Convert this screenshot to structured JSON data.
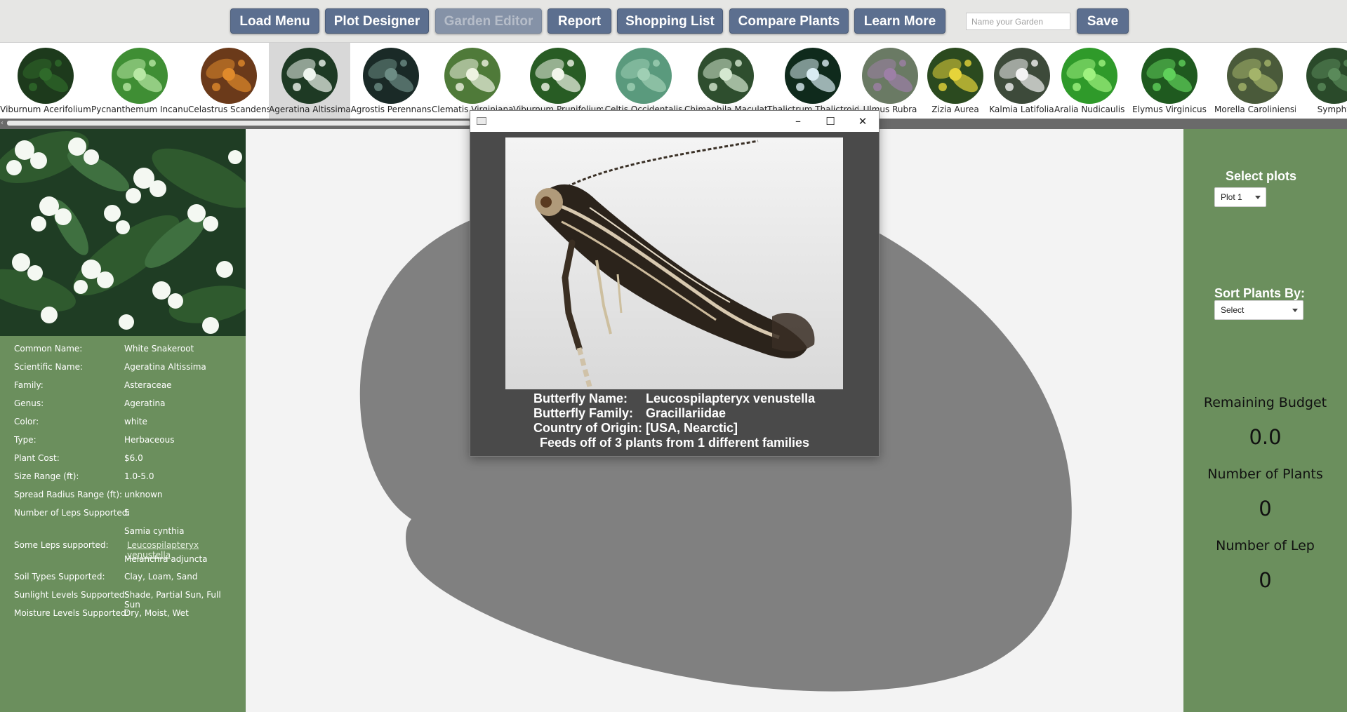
{
  "toolbar": {
    "buttons": [
      {
        "label": "Load Menu",
        "enabled": true
      },
      {
        "label": "Plot Designer",
        "enabled": true
      },
      {
        "label": "Garden Editor",
        "enabled": false
      },
      {
        "label": "Report",
        "enabled": true
      },
      {
        "label": "Shopping List",
        "enabled": true
      },
      {
        "label": "Compare Plants",
        "enabled": true
      },
      {
        "label": "Learn More",
        "enabled": true
      }
    ],
    "garden_name": {
      "value": "",
      "placeholder": "Name your Garden"
    },
    "save_label": "Save"
  },
  "plant_strip": {
    "selected_index": 3,
    "plants": [
      {
        "name": "Viburnum Acerifolium",
        "bg": "#1d3a1c",
        "fg": "#2f6a2a"
      },
      {
        "name": "Pycnanthemum Incanum",
        "bg": "#3f8e34",
        "fg": "#b8e8a4"
      },
      {
        "name": "Celastrus Scandens",
        "bg": "#6b3a1a",
        "fg": "#e08a2b"
      },
      {
        "name": "Ageratina Altissima",
        "bg": "#1e3a24",
        "fg": "#eef5ee"
      },
      {
        "name": "Agrostis Perennans",
        "bg": "#1a2a27",
        "fg": "#6c8c84"
      },
      {
        "name": "Clematis Virginiana",
        "bg": "#4f7a39",
        "fg": "#eef3e1"
      },
      {
        "name": "Viburnum Prunifolium",
        "bg": "#285c24",
        "fg": "#f1f6ea"
      },
      {
        "name": "Celtis Occidentalis",
        "bg": "#5a9a7d",
        "fg": "#9fcfb4"
      },
      {
        "name": "Chimaphila Maculata",
        "bg": "#2e4e2e",
        "fg": "#d4e8d0"
      },
      {
        "name": "Thalictrum Thalictroides",
        "bg": "#0f2a1c",
        "fg": "#d9ecf2"
      },
      {
        "name": "Ulmus Rubra",
        "bg": "#6a7a64",
        "fg": "#9d7fa6"
      },
      {
        "name": "Zizia Aurea",
        "bg": "#2b4a1f",
        "fg": "#e6d43a"
      },
      {
        "name": "Kalmia Latifolia",
        "bg": "#3d4a3a",
        "fg": "#f3f3f3"
      },
      {
        "name": "Aralia Nudicaulis",
        "bg": "#2f9a2a",
        "fg": "#9ff27f"
      },
      {
        "name": "Elymus Virginicus",
        "bg": "#1f5a1f",
        "fg": "#5fd05a"
      },
      {
        "name": "Morella Caroliniensis",
        "bg": "#4a5a3a",
        "fg": "#a4b46a"
      },
      {
        "name": "Symphy",
        "bg": "#2a4a2a",
        "fg": "#5a8a5a"
      }
    ]
  },
  "details": {
    "rows": [
      {
        "label": "Common Name:",
        "value": "White Snakeroot"
      },
      {
        "label": "Scientific Name:",
        "value": "Ageratina Altissima"
      },
      {
        "label": "Family:",
        "value": "Asteraceae"
      },
      {
        "label": "Genus:",
        "value": "Ageratina"
      },
      {
        "label": "Color:",
        "value": "white"
      },
      {
        "label": "Type:",
        "value": "Herbaceous"
      },
      {
        "label": "Plant Cost:",
        "value": "$6.0"
      },
      {
        "label": "Size Range (ft):",
        "value": "1.0-5.0"
      },
      {
        "label": "Spread Radius Range (ft):",
        "value": "unknown"
      },
      {
        "label": "Number of Leps Supported:",
        "value": "5"
      }
    ],
    "leps_label": "Some Leps supported:",
    "leps": [
      "Samia cynthia",
      "Leucospilapteryx venustella",
      "Melanchra adjuncta"
    ],
    "rows_after": [
      {
        "label": "Soil Types Supported:",
        "value": "Clay, Loam, Sand"
      },
      {
        "label": "Sunlight Levels Supported:",
        "value": "Shade, Partial Sun, Full Sun"
      },
      {
        "label": "Moisture Levels Supported:",
        "value": "Dry, Moist, Wet"
      }
    ]
  },
  "right_panel": {
    "select_plots_label": "Select plots",
    "plot_select_value": "Plot 1",
    "sort_label": "Sort Plants By:",
    "sort_select_value": "Select",
    "budget_label": "Remaining Budget",
    "budget_value": "0.0",
    "num_plants_label": "Number of Plants",
    "num_plants_value": "0",
    "num_lep_label": "Number of Lep",
    "num_lep_value": "0"
  },
  "popup": {
    "minimize_glyph": "–",
    "maximize_glyph": "☐",
    "close_glyph": "✕",
    "butterfly_name_label": "Butterfly Name:",
    "butterfly_name": "Leucospilapteryx venustella",
    "butterfly_family_label": "Butterfly Family:",
    "butterfly_family": "Gracillariidae",
    "origin_label": "Country of Origin:",
    "origin": "[USA, Nearctic]",
    "feeds_text": "Feeds off of 3 plants from 1 different families"
  },
  "colors": {
    "panel_green": "#6b8f5d",
    "button_blue": "#5c6f8f",
    "plot_gray": "#808080",
    "popup_bg": "#4a4a4a"
  }
}
